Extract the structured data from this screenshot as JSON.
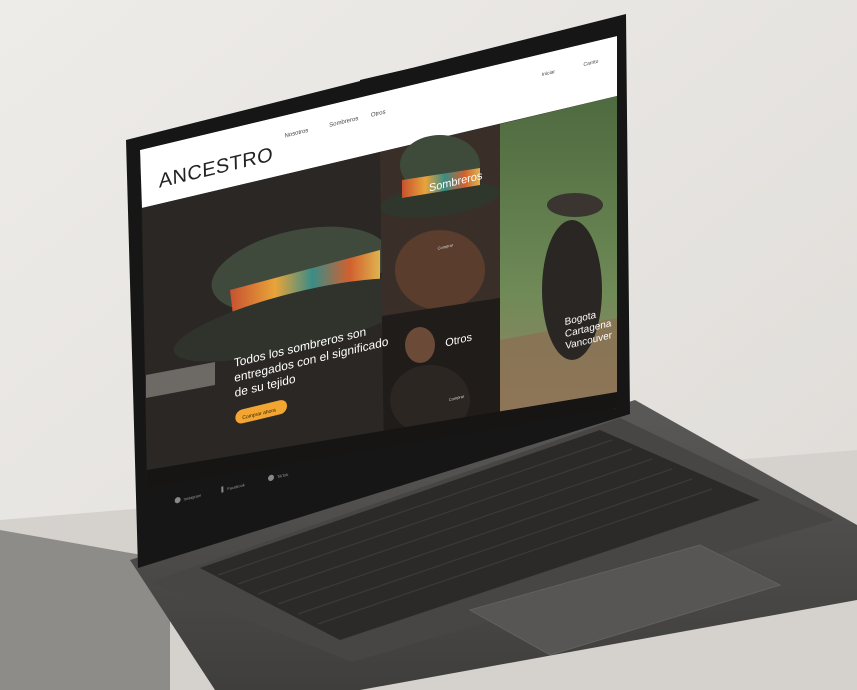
{
  "site": {
    "logo": "ANCESTRO",
    "nav": [
      "Nosotros",
      "Sombreros",
      "Otros"
    ],
    "header_right": [
      "Iniciar",
      "Carrito"
    ],
    "hero": {
      "headline": [
        "Todos los sombreros son",
        "entregados con el significado",
        "de su tejido"
      ],
      "cta": "Comprar ahora"
    },
    "categories": [
      {
        "title": "Sombreros",
        "sub": "Comprar"
      },
      {
        "title": "Otros",
        "sub": "Comprar"
      },
      {
        "title": [
          "Bogota",
          "Cartagena",
          "Vancouver"
        ]
      }
    ],
    "footer": [
      "Instagram",
      "Facebook",
      "TikTok"
    ]
  },
  "colors": {
    "accent": "#f2a531",
    "screen_dark": "#1e1c1a",
    "header": "#ffffff",
    "laptop_body": "#4d4c4a"
  }
}
